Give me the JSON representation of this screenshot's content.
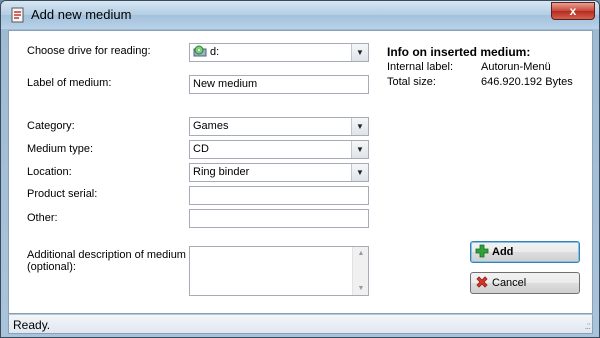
{
  "window": {
    "title": "Add new medium",
    "close_label": "x"
  },
  "form": {
    "drive_label": "Choose drive for reading:",
    "drive_value": "d:",
    "medium_label_label": "Label of medium:",
    "medium_label_value": "New medium",
    "category_label": "Category:",
    "category_value": "Games",
    "medium_type_label": "Medium type:",
    "medium_type_value": "CD",
    "location_label": "Location:",
    "location_value": "Ring binder",
    "product_serial_label": "Product serial:",
    "product_serial_value": "",
    "other_label": "Other:",
    "other_value": "",
    "description_label_line1": "Additional description of medium",
    "description_label_line2": "(optional):",
    "description_value": ""
  },
  "info": {
    "title": "Info on inserted medium:",
    "internal_label_label": "Internal label:",
    "internal_label_value": "Autorun-Menü",
    "total_size_label": "Total size:",
    "total_size_value": "646.920.192 Bytes"
  },
  "buttons": {
    "add_label": "Add",
    "cancel_label": "Cancel"
  },
  "status": {
    "text": "Ready."
  },
  "icons": {
    "title": "medium-add-icon",
    "drive": "cd-drive-icon",
    "add": "green-plus-icon",
    "cancel": "red-x-icon"
  },
  "colors": {
    "add_icon": "#2fa33a",
    "cancel_icon": "#d8382c"
  }
}
